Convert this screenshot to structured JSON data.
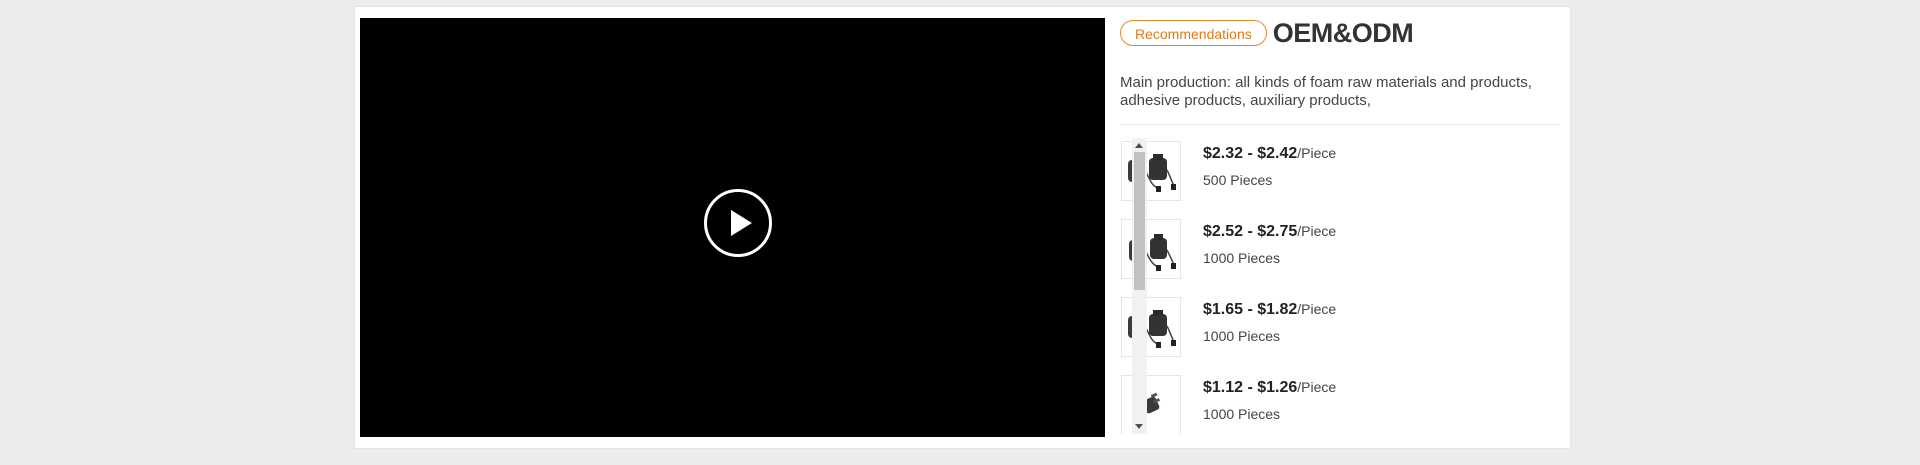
{
  "video": {
    "play_icon": "play-icon"
  },
  "header": {
    "badge": "Recommendations",
    "title": "OEM&ODM"
  },
  "description": "Main production: all kinds of foam raw materials and products, adhesive products, auxiliary products,",
  "products": [
    {
      "price": "$2.32 - $2.42",
      "unit": "/Piece",
      "moq": "500 Pieces",
      "icon": "adapter-pair-icon"
    },
    {
      "price": "$2.52 - $2.75",
      "unit": "/Piece",
      "moq": "1000 Pieces",
      "icon": "adapter-pair-icon"
    },
    {
      "price": "$1.65 - $1.82",
      "unit": "/Piece",
      "moq": "1000 Pieces",
      "icon": "adapter-pair-icon"
    },
    {
      "price": "$1.12 - $1.26",
      "unit": "/Piece",
      "moq": "1000 Pieces",
      "icon": "single-adapter-icon"
    }
  ],
  "colors": {
    "accent": "#e07a14",
    "video_bg": "#000000",
    "page_bg": "#ececec"
  }
}
